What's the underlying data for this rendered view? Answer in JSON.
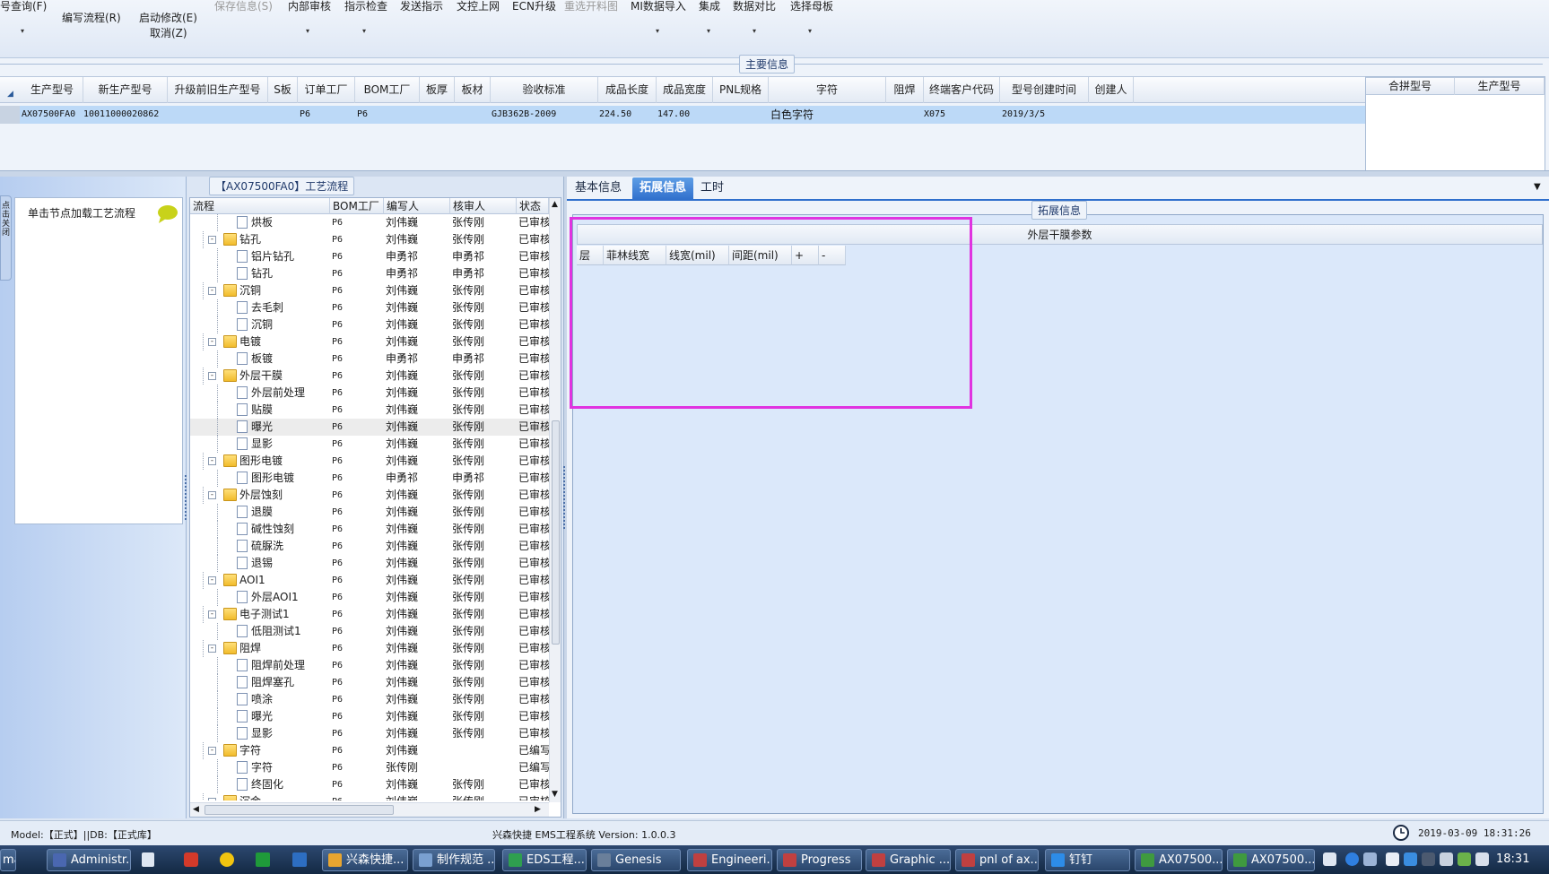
{
  "toolbar": {
    "items": [
      {
        "label": "号查询(F)",
        "disabled": false
      },
      {
        "label": "编写流程(R)",
        "disabled": false
      },
      {
        "label": "启动修改(E)",
        "disabled": false
      },
      {
        "label": "取消(Z)",
        "disabled": false
      },
      {
        "label": "保存信息(S)",
        "disabled": true
      },
      {
        "label": "内部审核",
        "disabled": false
      },
      {
        "label": "指示检查",
        "disabled": false
      },
      {
        "label": "发送指示",
        "disabled": false
      },
      {
        "label": "文控上网",
        "disabled": false
      },
      {
        "label": "ECN升级",
        "disabled": false
      },
      {
        "label": "重选开料图",
        "disabled": true
      },
      {
        "label": "MI数据导入",
        "disabled": false
      },
      {
        "label": "集成",
        "disabled": false
      },
      {
        "label": "数据对比",
        "disabled": false
      },
      {
        "label": "选择母板",
        "disabled": false
      }
    ]
  },
  "main_info": {
    "title": "主要信息",
    "columns": [
      "生产型号",
      "新生产型号",
      "升级前旧生产型号",
      "S板",
      "订单工厂",
      "BOM工厂",
      "板厚",
      "板材",
      "验收标准",
      "成品长度",
      "成品宽度",
      "PNL规格",
      "字符",
      "阻焊",
      "终端客户代码",
      "型号创建时间",
      "创建人"
    ],
    "row": [
      "AX07500FA0",
      "10011000020862",
      "",
      "",
      "P6",
      "P6",
      "",
      "",
      "GJB362B-2009",
      "224.50",
      "147.00",
      "",
      "白色字符",
      "",
      "X075",
      "2019/3/5",
      ""
    ],
    "side_columns": [
      "合拼型号",
      "生产型号"
    ]
  },
  "left_panel": {
    "node_hint": "单击节点加载工艺流程",
    "vertical_tab": "点击关闭"
  },
  "process": {
    "title": "【AX07500FA0】工艺流程",
    "columns": [
      "流程",
      "BOM工厂",
      "编写人",
      "核审人",
      "状态"
    ],
    "rows": [
      {
        "name": "烘板",
        "level": 2,
        "bom": "P6",
        "writer": "刘伟巍",
        "reviewer": "张传刚",
        "status": "已审核"
      },
      {
        "name": "钻孔",
        "level": 1,
        "bom": "P6",
        "writer": "刘伟巍",
        "reviewer": "张传刚",
        "status": "已审核"
      },
      {
        "name": "铝片钻孔",
        "level": 2,
        "bom": "P6",
        "writer": "申勇祁",
        "reviewer": "申勇祁",
        "status": "已审核"
      },
      {
        "name": "钻孔",
        "level": 2,
        "bom": "P6",
        "writer": "申勇祁",
        "reviewer": "申勇祁",
        "status": "已审核"
      },
      {
        "name": "沉铜",
        "level": 1,
        "bom": "P6",
        "writer": "刘伟巍",
        "reviewer": "张传刚",
        "status": "已审核"
      },
      {
        "name": "去毛刺",
        "level": 2,
        "bom": "P6",
        "writer": "刘伟巍",
        "reviewer": "张传刚",
        "status": "已审核"
      },
      {
        "name": "沉铜",
        "level": 2,
        "bom": "P6",
        "writer": "刘伟巍",
        "reviewer": "张传刚",
        "status": "已审核"
      },
      {
        "name": "电镀",
        "level": 1,
        "bom": "P6",
        "writer": "刘伟巍",
        "reviewer": "张传刚",
        "status": "已审核"
      },
      {
        "name": "板镀",
        "level": 2,
        "bom": "P6",
        "writer": "申勇祁",
        "reviewer": "申勇祁",
        "status": "已审核"
      },
      {
        "name": "外层干膜",
        "level": 1,
        "bom": "P6",
        "writer": "刘伟巍",
        "reviewer": "张传刚",
        "status": "已审核"
      },
      {
        "name": "外层前处理",
        "level": 2,
        "bom": "P6",
        "writer": "刘伟巍",
        "reviewer": "张传刚",
        "status": "已审核"
      },
      {
        "name": "贴膜",
        "level": 2,
        "bom": "P6",
        "writer": "刘伟巍",
        "reviewer": "张传刚",
        "status": "已审核"
      },
      {
        "name": "曝光",
        "level": 2,
        "bom": "P6",
        "writer": "刘伟巍",
        "reviewer": "张传刚",
        "status": "已审核",
        "selected": true
      },
      {
        "name": "显影",
        "level": 2,
        "bom": "P6",
        "writer": "刘伟巍",
        "reviewer": "张传刚",
        "status": "已审核"
      },
      {
        "name": "图形电镀",
        "level": 1,
        "bom": "P6",
        "writer": "刘伟巍",
        "reviewer": "张传刚",
        "status": "已审核"
      },
      {
        "name": "图形电镀",
        "level": 2,
        "bom": "P6",
        "writer": "申勇祁",
        "reviewer": "申勇祁",
        "status": "已审核"
      },
      {
        "name": "外层蚀刻",
        "level": 1,
        "bom": "P6",
        "writer": "刘伟巍",
        "reviewer": "张传刚",
        "status": "已审核"
      },
      {
        "name": "退膜",
        "level": 2,
        "bom": "P6",
        "writer": "刘伟巍",
        "reviewer": "张传刚",
        "status": "已审核"
      },
      {
        "name": "碱性蚀刻",
        "level": 2,
        "bom": "P6",
        "writer": "刘伟巍",
        "reviewer": "张传刚",
        "status": "已审核"
      },
      {
        "name": "硫脲洗",
        "level": 2,
        "bom": "P6",
        "writer": "刘伟巍",
        "reviewer": "张传刚",
        "status": "已审核"
      },
      {
        "name": "退锡",
        "level": 2,
        "bom": "P6",
        "writer": "刘伟巍",
        "reviewer": "张传刚",
        "status": "已审核"
      },
      {
        "name": "AOI1",
        "level": 1,
        "bom": "P6",
        "writer": "刘伟巍",
        "reviewer": "张传刚",
        "status": "已审核"
      },
      {
        "name": "外层AOI1",
        "level": 2,
        "bom": "P6",
        "writer": "刘伟巍",
        "reviewer": "张传刚",
        "status": "已审核"
      },
      {
        "name": "电子测试1",
        "level": 1,
        "bom": "P6",
        "writer": "刘伟巍",
        "reviewer": "张传刚",
        "status": "已审核"
      },
      {
        "name": "低阻测试1",
        "level": 2,
        "bom": "P6",
        "writer": "刘伟巍",
        "reviewer": "张传刚",
        "status": "已审核"
      },
      {
        "name": "阻焊",
        "level": 1,
        "bom": "P6",
        "writer": "刘伟巍",
        "reviewer": "张传刚",
        "status": "已审核"
      },
      {
        "name": "阻焊前处理",
        "level": 2,
        "bom": "P6",
        "writer": "刘伟巍",
        "reviewer": "张传刚",
        "status": "已审核"
      },
      {
        "name": "阻焊塞孔",
        "level": 2,
        "bom": "P6",
        "writer": "刘伟巍",
        "reviewer": "张传刚",
        "status": "已审核"
      },
      {
        "name": "喷涂",
        "level": 2,
        "bom": "P6",
        "writer": "刘伟巍",
        "reviewer": "张传刚",
        "status": "已审核"
      },
      {
        "name": "曝光",
        "level": 2,
        "bom": "P6",
        "writer": "刘伟巍",
        "reviewer": "张传刚",
        "status": "已审核"
      },
      {
        "name": "显影",
        "level": 2,
        "bom": "P6",
        "writer": "刘伟巍",
        "reviewer": "张传刚",
        "status": "已审核"
      },
      {
        "name": "字符",
        "level": 1,
        "bom": "P6",
        "writer": "刘伟巍",
        "reviewer": "",
        "status": "已编写"
      },
      {
        "name": "字符",
        "level": 2,
        "bom": "P6",
        "writer": "张传刚",
        "reviewer": "",
        "status": "已编写"
      },
      {
        "name": "终固化",
        "level": 2,
        "bom": "P6",
        "writer": "刘伟巍",
        "reviewer": "张传刚",
        "status": "已审核"
      },
      {
        "name": "沉金",
        "level": 1,
        "bom": "P6",
        "writer": "刘伟巍",
        "reviewer": "张传刚",
        "status": "已审核"
      }
    ]
  },
  "right_panel": {
    "tabs": [
      {
        "label": "基本信息",
        "active": false
      },
      {
        "label": "拓展信息",
        "active": true
      },
      {
        "label": "工时",
        "active": false
      }
    ],
    "group_title": "拓展信息",
    "table_title": "外层干膜参数",
    "columns": [
      "层",
      "菲林线宽",
      "线宽(mil)",
      "间距(mil)",
      "+",
      "-"
    ]
  },
  "status_bar": {
    "model": "Model:【正式】||DB:【正式库】",
    "center": "兴森快捷 EMS工程系统 Version: 1.0.0.3",
    "datetime": "2019-03-09 18:31:26"
  },
  "taskbar": {
    "items": [
      {
        "label": "mail",
        "color": "#3a78c8"
      },
      {
        "label": "Administr...",
        "color": "#4a67b0"
      },
      {
        "label": "兴森快捷...",
        "color": "#e8a530"
      },
      {
        "label": "制作规范 ...",
        "color": "#7aa0d0"
      },
      {
        "label": "EDS工程...",
        "color": "#2f9f4f"
      },
      {
        "label": "Genesis",
        "color": "#6a7f9a"
      },
      {
        "label": "Engineeri...",
        "color": "#c04040"
      },
      {
        "label": "Progress",
        "color": "#c04040"
      },
      {
        "label": "Graphic ...",
        "color": "#c04040"
      },
      {
        "label": "pnl of ax...",
        "color": "#c04040"
      },
      {
        "label": "钉钉",
        "color": "#2d8ce8"
      },
      {
        "label": "AX07500...",
        "color": "#3f9a3f"
      },
      {
        "label": "AX07500...",
        "color": "#3f9a3f"
      }
    ],
    "clock": "18:31"
  },
  "colors": {
    "highlight_box": "#e033e0",
    "selected_row": "#bcd9f7",
    "active_tab": "#2f6fcc"
  }
}
